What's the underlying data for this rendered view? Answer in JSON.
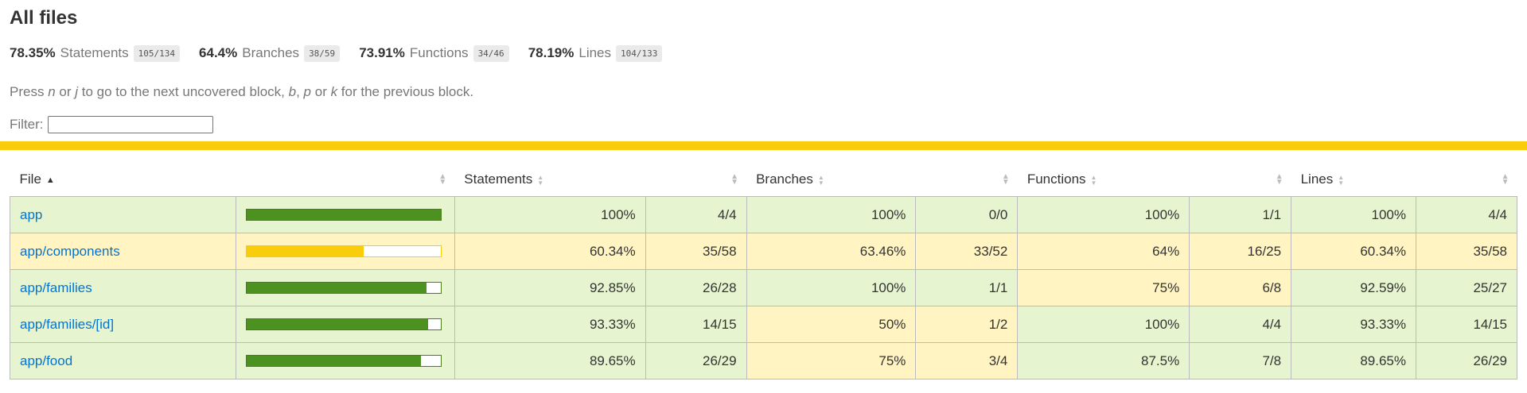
{
  "header": {
    "title": "All files",
    "summary": [
      {
        "pct": "78.35%",
        "label": "Statements",
        "frac": "105/134"
      },
      {
        "pct": "64.4%",
        "label": "Branches",
        "frac": "38/59"
      },
      {
        "pct": "73.91%",
        "label": "Functions",
        "frac": "34/46"
      },
      {
        "pct": "78.19%",
        "label": "Lines",
        "frac": "104/133"
      }
    ],
    "help": {
      "p1": "Press ",
      "k1": "n",
      "p2": " or ",
      "k2": "j",
      "p3": " to go to the next uncovered block, ",
      "k3": "b",
      "p4": ", ",
      "k4": "p",
      "p5": " or ",
      "k5": "k",
      "p6": " for the previous block."
    },
    "filter_label": "Filter:",
    "filter_value": ""
  },
  "colors": {
    "high_bg": "#e6f5d0",
    "medium_bg": "#fff4c2",
    "status_bar": "#f9cd0b",
    "bar_high": "#4d9221",
    "bar_medium": "#f9cd0b",
    "link": "#0074d9"
  },
  "table": {
    "headers": {
      "file": "File",
      "statements": "Statements",
      "branches": "Branches",
      "functions": "Functions",
      "lines": "Lines"
    },
    "sort_icons": {
      "active": "sort-ascending-icon",
      "inactive": "sort-icon"
    },
    "rows": [
      {
        "file": "app",
        "status": "high",
        "coverage": 1.0,
        "stmt_pct": "100%",
        "stmt_frac": "4/4",
        "stmt_status": "high",
        "br_pct": "100%",
        "br_frac": "0/0",
        "br_status": "high",
        "fn_pct": "100%",
        "fn_frac": "1/1",
        "fn_status": "high",
        "ln_pct": "100%",
        "ln_frac": "4/4",
        "ln_status": "high"
      },
      {
        "file": "app/components",
        "status": "medium",
        "coverage": 0.6034,
        "stmt_pct": "60.34%",
        "stmt_frac": "35/58",
        "stmt_status": "medium",
        "br_pct": "63.46%",
        "br_frac": "33/52",
        "br_status": "medium",
        "fn_pct": "64%",
        "fn_frac": "16/25",
        "fn_status": "medium",
        "ln_pct": "60.34%",
        "ln_frac": "35/58",
        "ln_status": "medium"
      },
      {
        "file": "app/families",
        "status": "high",
        "coverage": 0.9285,
        "stmt_pct": "92.85%",
        "stmt_frac": "26/28",
        "stmt_status": "high",
        "br_pct": "100%",
        "br_frac": "1/1",
        "br_status": "high",
        "fn_pct": "75%",
        "fn_frac": "6/8",
        "fn_status": "medium",
        "ln_pct": "92.59%",
        "ln_frac": "25/27",
        "ln_status": "high"
      },
      {
        "file": "app/families/[id]",
        "status": "high",
        "coverage": 0.9333,
        "stmt_pct": "93.33%",
        "stmt_frac": "14/15",
        "stmt_status": "high",
        "br_pct": "50%",
        "br_frac": "1/2",
        "br_status": "medium",
        "fn_pct": "100%",
        "fn_frac": "4/4",
        "fn_status": "high",
        "ln_pct": "93.33%",
        "ln_frac": "14/15",
        "ln_status": "high"
      },
      {
        "file": "app/food",
        "status": "high",
        "coverage": 0.8965,
        "stmt_pct": "89.65%",
        "stmt_frac": "26/29",
        "stmt_status": "high",
        "br_pct": "75%",
        "br_frac": "3/4",
        "br_status": "medium",
        "fn_pct": "87.5%",
        "fn_frac": "7/8",
        "fn_status": "high",
        "ln_pct": "89.65%",
        "ln_frac": "26/29",
        "ln_status": "high"
      }
    ]
  }
}
